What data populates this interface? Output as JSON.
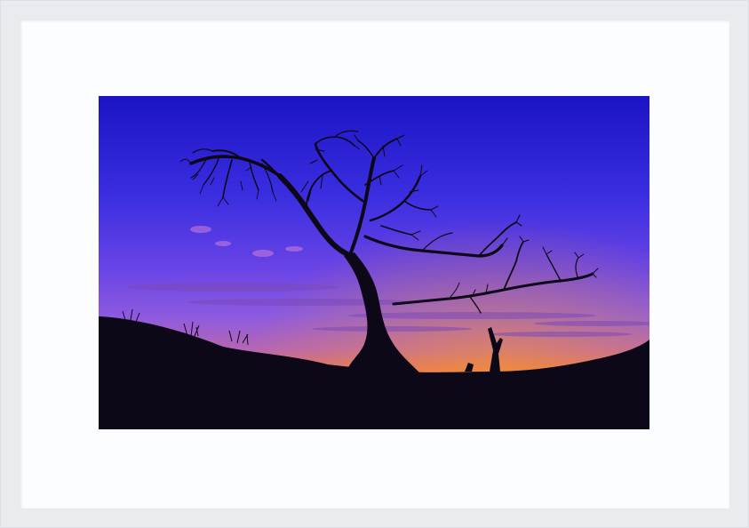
{
  "artwork": {
    "subject": "tree-silhouette-at-sunset",
    "colors": {
      "frame": "#e9ebee",
      "mat": "#fcfdfe",
      "sky_top": "#1e1ec8",
      "sky_mid": "#5a3ce0",
      "sky_violet": "#8a5ae6",
      "horizon_pink": "#c46aa8",
      "horizon_orange": "#f07a2a",
      "horizon_yellow": "#f5a020",
      "silhouette": "#0d0818"
    }
  }
}
